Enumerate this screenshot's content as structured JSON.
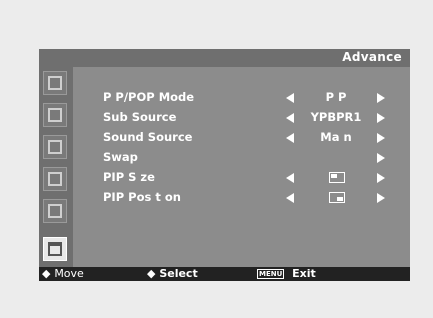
{
  "header": {
    "title": "Advance"
  },
  "sidebar": {
    "icons": [
      "picture-icon",
      "sound-icon",
      "channel-icon",
      "setup-icon",
      "input-icon",
      "advance-icon"
    ],
    "active": "advance-icon"
  },
  "menu": {
    "rows": [
      {
        "label": "P P/POP Mode",
        "value": "P P"
      },
      {
        "label": "Sub Source",
        "value": "YPBPR1"
      },
      {
        "label": "Sound Source",
        "value": "Ma n"
      },
      {
        "label": "Swap",
        "value": ""
      },
      {
        "label": "PIP S ze",
        "value": ""
      },
      {
        "label": "PIP Pos t on",
        "value": ""
      }
    ]
  },
  "footer": {
    "move": "Move",
    "select": "Select",
    "exit": "Exit",
    "menu_key": "MENU"
  },
  "colors": {
    "panel": "#8c8c8c",
    "header": "#6f6f6f",
    "footer": "#222222",
    "text": "#ffffff"
  }
}
